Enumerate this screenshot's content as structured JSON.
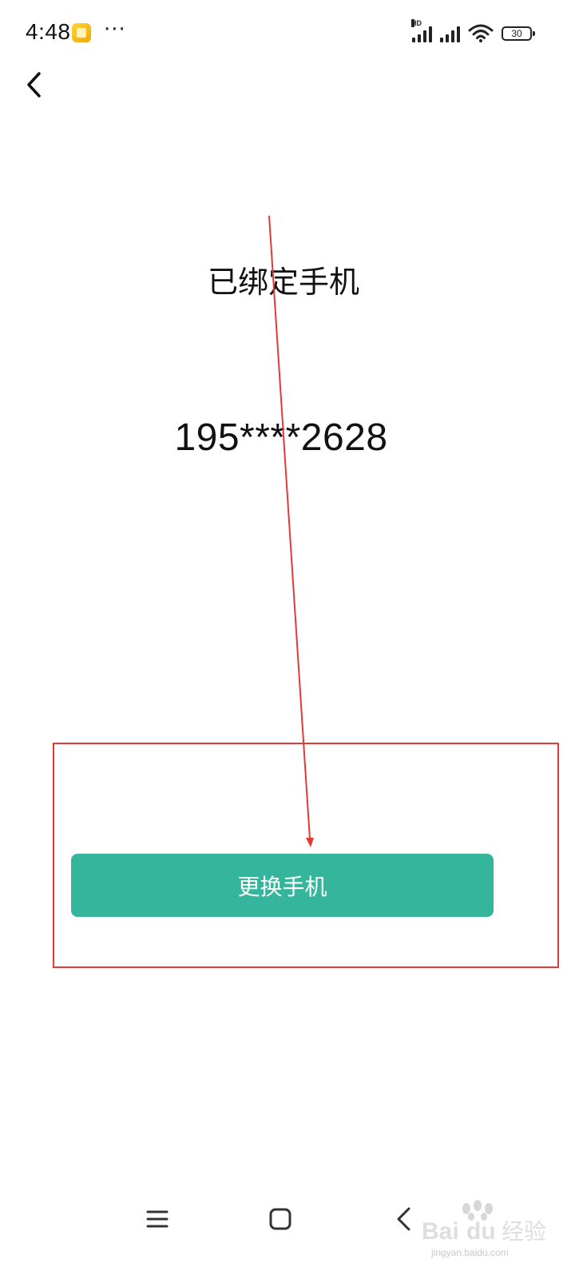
{
  "status_bar": {
    "time": "4:48",
    "more": "···",
    "network_tag": "HD",
    "battery_level": "30",
    "notification_icon": "app-notification-icon",
    "icons": [
      "signal-icon",
      "signal-icon",
      "wifi-icon",
      "battery-icon"
    ]
  },
  "header": {
    "back_icon": "chevron-left-icon"
  },
  "main": {
    "title": "已绑定手机",
    "phone_number": "195****2628",
    "change_button_label": "更换手机"
  },
  "annotation": {
    "color": "#e23a36"
  },
  "nav_bar": {
    "icons": [
      "menu-icon",
      "home-icon",
      "back-icon"
    ]
  },
  "watermark": {
    "text": "Baidu经验",
    "url": "jingyan.baidu.com"
  },
  "colors": {
    "accent": "#35b59b",
    "text": "#111111",
    "background": "#ffffff"
  }
}
